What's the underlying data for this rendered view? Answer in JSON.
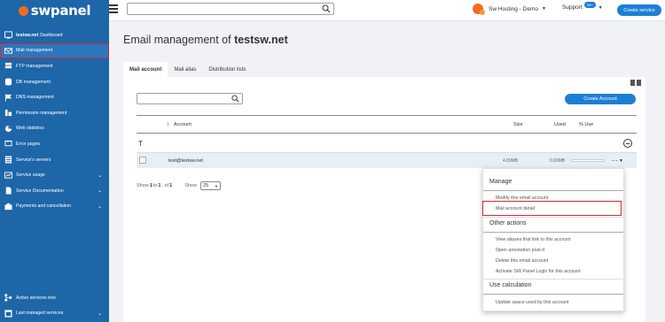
{
  "brand": {
    "logo_text": "swpanel"
  },
  "sidebar": {
    "items": [
      {
        "bold": "testsw.net",
        "label": "Dashboard",
        "icon": "dashboard-icon",
        "chevron": false
      },
      {
        "label": "Mail management",
        "icon": "mail-icon",
        "chevron": false
      },
      {
        "label": "FTP management",
        "icon": "ftp-icon",
        "chevron": false
      },
      {
        "label": "DB management",
        "icon": "database-icon",
        "chevron": false
      },
      {
        "label": "DNS management",
        "icon": "flag-icon",
        "chevron": false
      },
      {
        "label": "Permission management",
        "icon": "permission-icon",
        "chevron": false
      },
      {
        "label": "Web statistics",
        "icon": "pie-chart-icon",
        "chevron": false
      },
      {
        "label": "Error pages",
        "icon": "error-page-icon",
        "chevron": false
      },
      {
        "label": "Service's servers",
        "icon": "server-icon",
        "chevron": false
      },
      {
        "label": "Service usage",
        "icon": "usage-icon",
        "chevron": true
      },
      {
        "label": "Service Documentation",
        "icon": "document-icon",
        "chevron": true
      },
      {
        "label": "Payments and cancellation",
        "icon": "payments-icon",
        "chevron": true
      }
    ],
    "bottom_items": [
      {
        "label": "Active services tree",
        "icon": "tree-icon",
        "chevron": false
      },
      {
        "label": "Last managed services",
        "icon": "history-icon",
        "chevron": true
      }
    ]
  },
  "topbar": {
    "account_name": "Sw Hosting - Demo",
    "support_label": "Support",
    "support_badge": "99+",
    "create_service": "Create service"
  },
  "page": {
    "title_prefix": "Email management of ",
    "title_domain": "testsw.net"
  },
  "tabs": [
    {
      "label": "Mail account",
      "active": true
    },
    {
      "label": "Mail alias",
      "active": false
    },
    {
      "label": "Distribution lists",
      "active": false
    }
  ],
  "list": {
    "create_button": "Create Account",
    "filter_letter": "T",
    "columns": {
      "account": "Account",
      "size": "Size",
      "used": "Used",
      "percent": "% Use"
    },
    "rows": [
      {
        "email": "test@testsw.net",
        "size": "4.09MB",
        "used": "0.00MB"
      }
    ],
    "pager": {
      "show_prefix": "Show ",
      "from": "1",
      "to_label": " to ",
      "to": "1",
      "of_label": ", of ",
      "total": "1",
      "show_label": "Show",
      "page_size": "25"
    }
  },
  "dropdown": {
    "manage_header": "Manage",
    "manage_items": [
      "Modify this email account",
      "Mail account detail"
    ],
    "other_header": "Other actions",
    "other_items": [
      "View aliases that link to this account",
      "Open annotation post-it",
      "Delete this email account",
      "Activate SW Panel Login for this account"
    ],
    "usage_header": "Use calculation",
    "usage_items": [
      "Update space used by this account"
    ]
  },
  "colors": {
    "sidebar": "#1d66a8",
    "accent": "#1d7fd4",
    "highlight": "#d9262e",
    "brand_orange": "#f26b21"
  }
}
